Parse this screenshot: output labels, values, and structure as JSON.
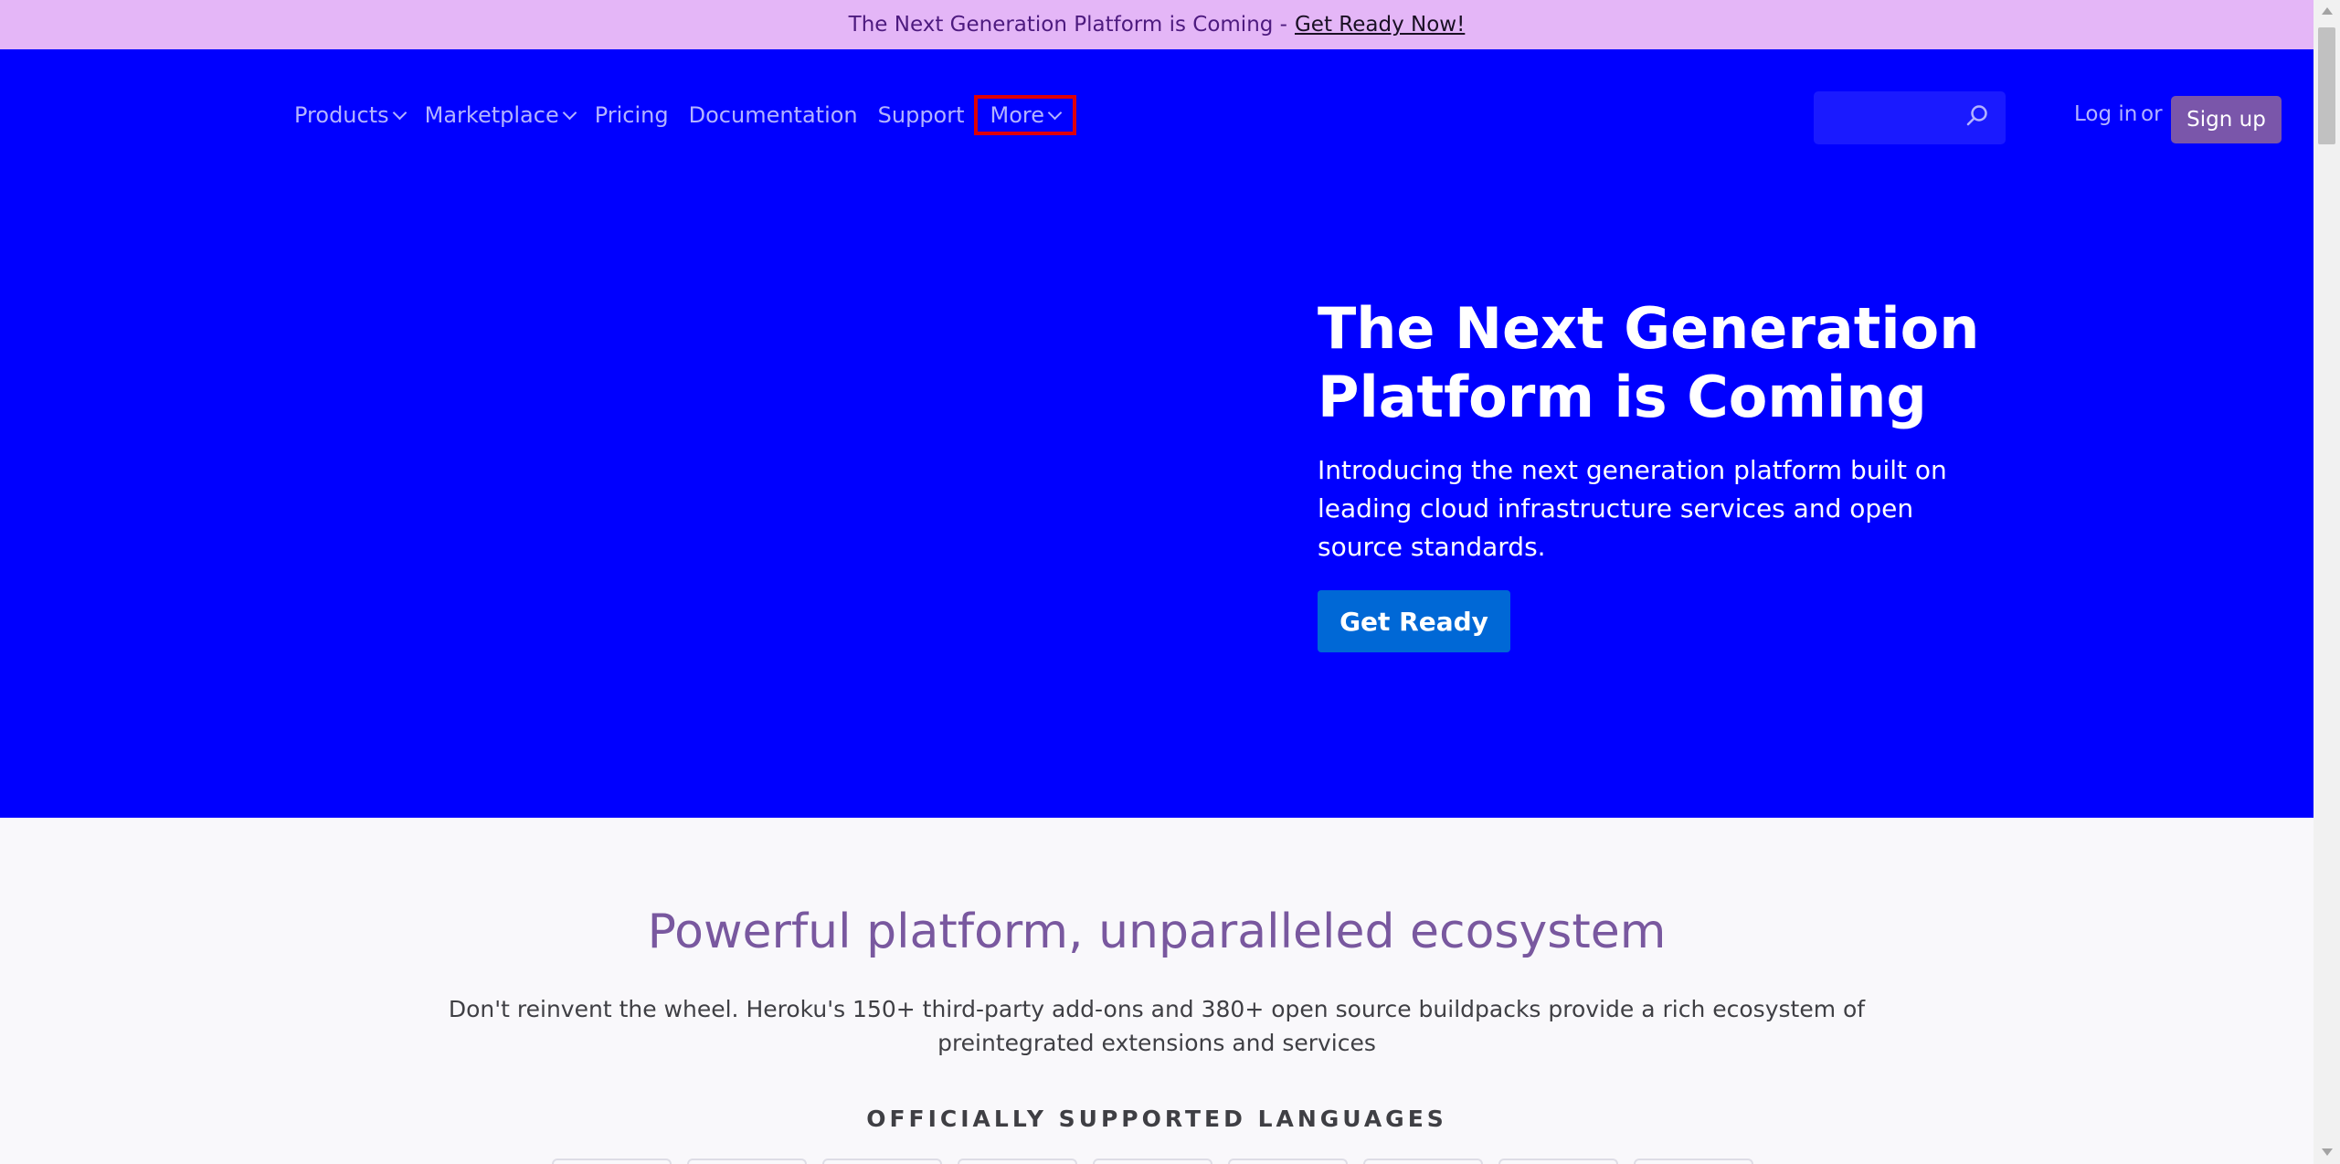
{
  "banner": {
    "text": "The Next Generation Platform is Coming -",
    "link": "Get Ready Now!"
  },
  "nav": {
    "items": [
      {
        "label": "Products"
      },
      {
        "label": "Marketplace"
      },
      {
        "label": "Pricing"
      },
      {
        "label": "Documentation"
      },
      {
        "label": "Support"
      },
      {
        "label": "More"
      }
    ]
  },
  "header": {
    "search_placeholder": "",
    "login_label": "Log in",
    "or_label": "or",
    "signup_label": "Sign up"
  },
  "hero": {
    "title": "The Next Generation Platform is Coming",
    "description": "Introducing the next generation platform built on leading cloud infrastructure services and open source standards.",
    "cta_label": "Get Ready"
  },
  "ecosystem": {
    "title": "Powerful platform, unparalleled ecosystem",
    "description": "Don't reinvent the wheel. Heroku's 150+ third-party add-ons and 380+ open source buildpacks provide a rich ecosystem of preintegrated extensions and services",
    "languages_heading": "OFFICIALLY SUPPORTED LANGUAGES"
  },
  "colors": {
    "banner_bg": "#e4b6f7",
    "hero_bg": "#0000ff",
    "accent_purple": "#79589f",
    "cta_blue": "#0068d6",
    "signup_bg": "#7a56aa",
    "highlight_box": "#e00000"
  }
}
